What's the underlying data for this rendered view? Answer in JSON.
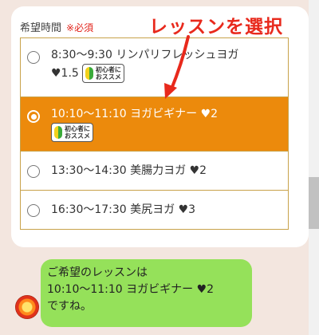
{
  "form": {
    "label": "希望時間",
    "required": "※必須"
  },
  "annotation": {
    "text": "レッスンを選択",
    "color": "#e8291c"
  },
  "options": [
    {
      "line1": "8:30〜9:30 リンパリフレッシュヨガ",
      "line2": "♥1.5",
      "badge": "初心者に\nおススメ",
      "selected": false
    },
    {
      "line1": "10:10〜11:10 ヨガビギナー ♥2",
      "badge": "初心者に\nおススメ",
      "selected": true
    },
    {
      "line1": "13:30〜14:30 美腸力ヨガ ♥2",
      "selected": false
    },
    {
      "line1": "16:30〜17:30 美尻ヨガ ♥3",
      "selected": false
    }
  ],
  "chat": {
    "lines": [
      "ご希望のレッスンは",
      "10:10〜11:10 ヨガビギナー ♥2",
      "ですね。"
    ]
  },
  "colors": {
    "selected_bg": "#ec8a0c",
    "border": "#c8a24a",
    "bubble": "#95e15a",
    "background": "#f3e6df"
  }
}
